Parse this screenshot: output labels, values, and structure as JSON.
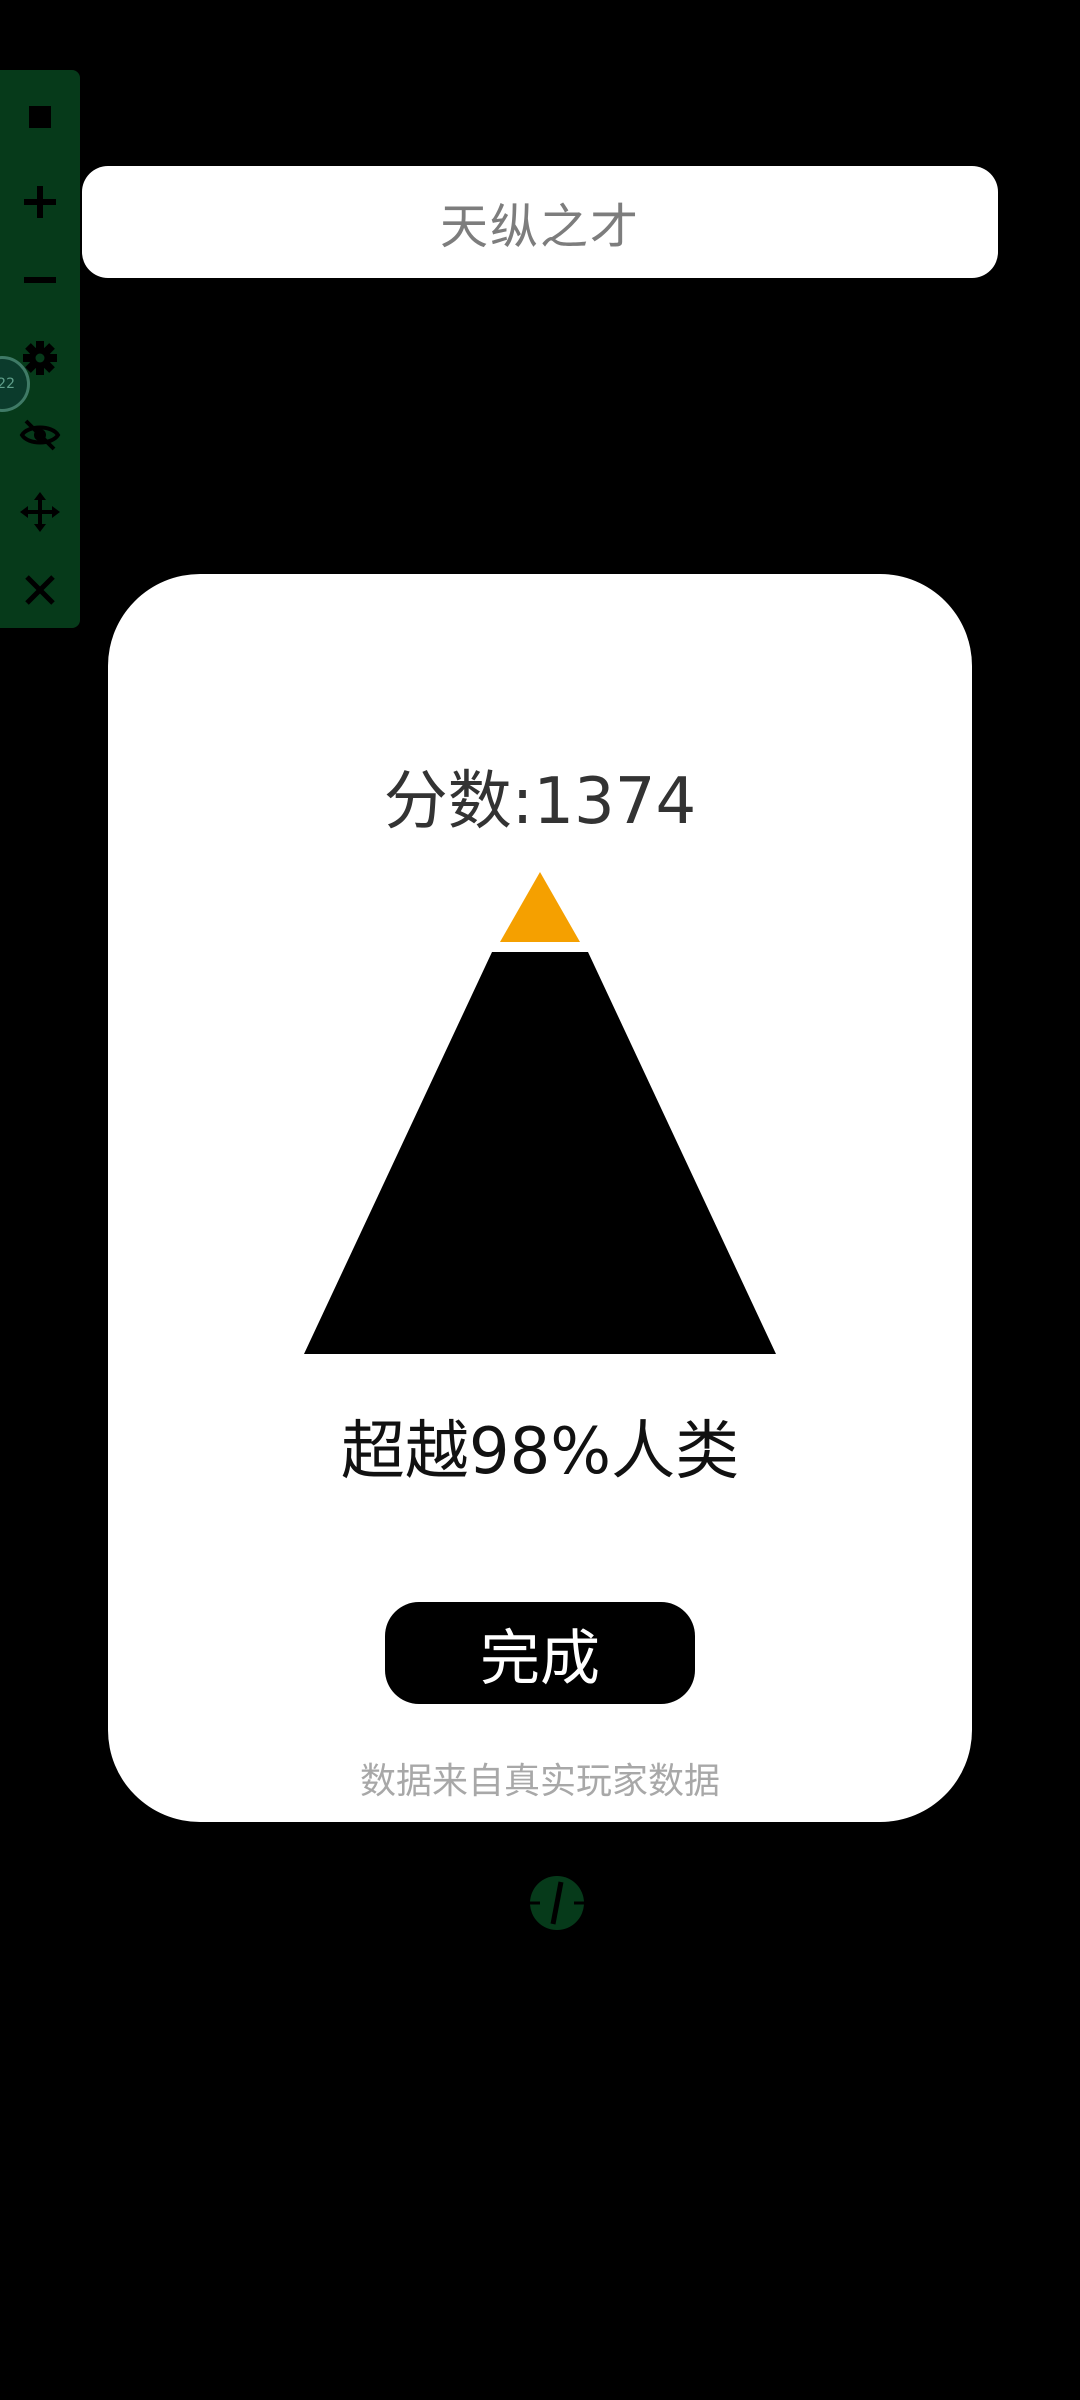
{
  "header": {
    "title": "天纵之才"
  },
  "result": {
    "score_text": "分数:1374",
    "exceed_text": "超越98%人类",
    "percentile": 98,
    "done_label": "完成",
    "source_note": "数据来自真实玩家数据"
  },
  "toolbar": {
    "bubble_text": "22",
    "icons": [
      "stop-icon",
      "plus-icon",
      "minus-icon",
      "gear-icon",
      "eye-off-icon",
      "move-icon",
      "close-icon"
    ]
  },
  "colors": {
    "toolbar_bg": "#063a1a",
    "pyramid_top": "#f5a000",
    "pyramid_body": "#000000",
    "button_bg": "#000000"
  }
}
